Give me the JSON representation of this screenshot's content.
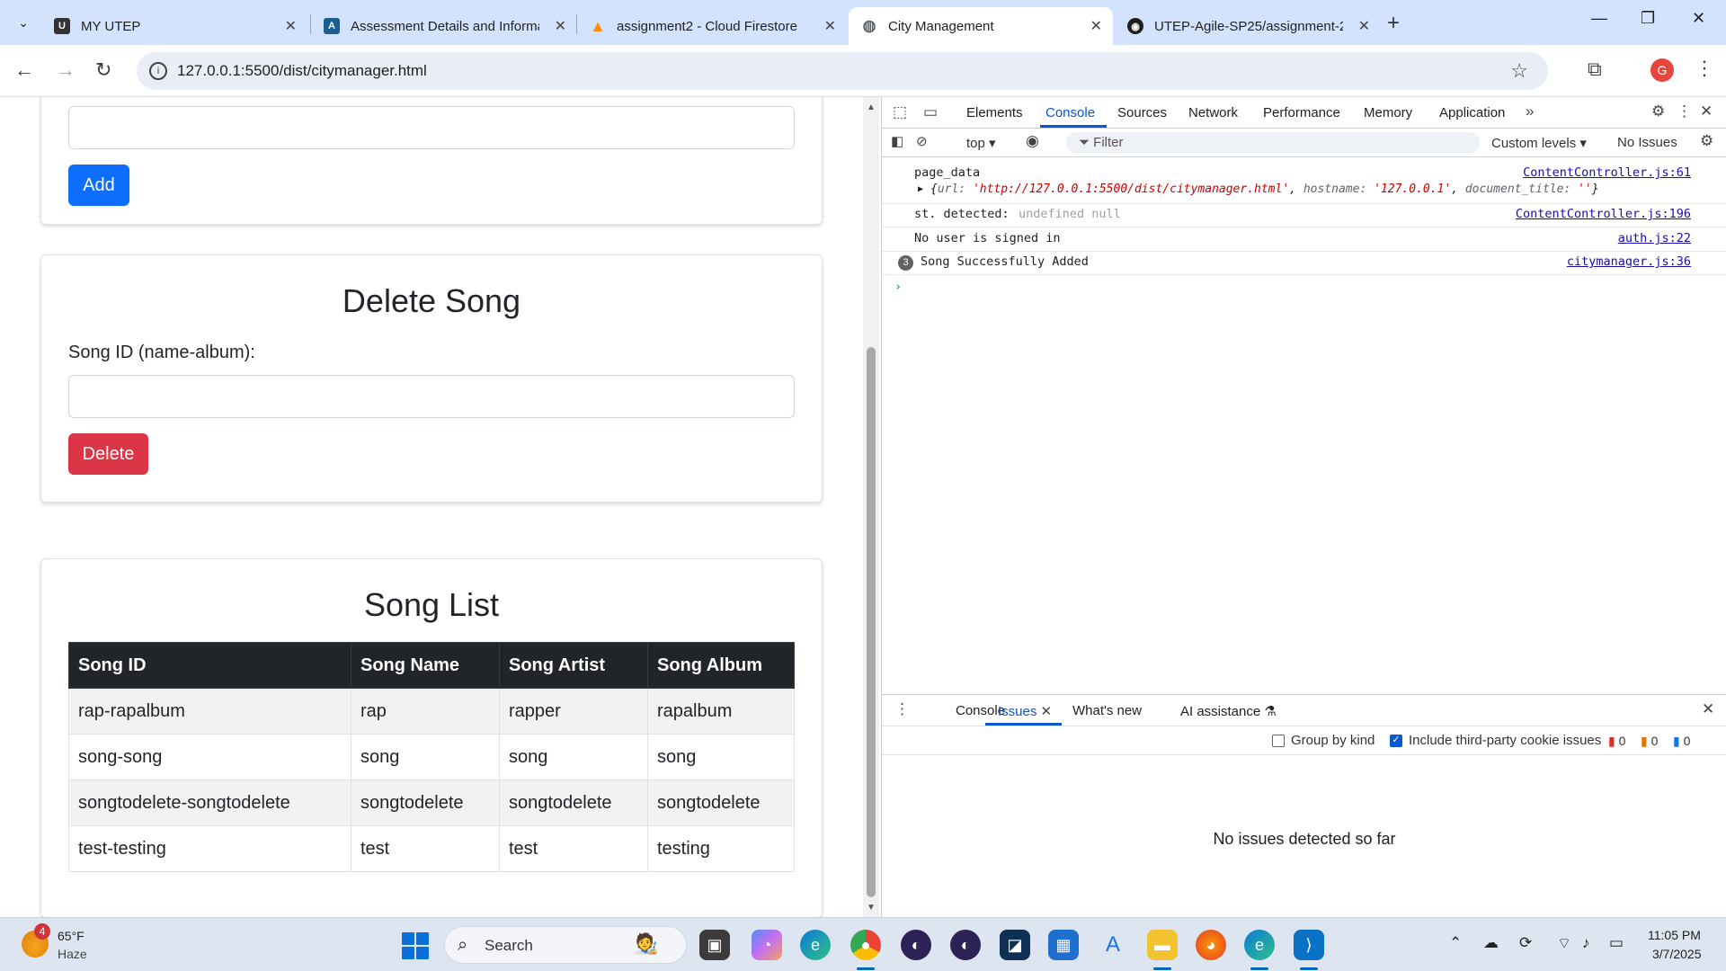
{
  "browser": {
    "tabs": [
      {
        "title": "MY UTEP",
        "fav": "utep-icon",
        "color": "#333333"
      },
      {
        "title": "Assessment Details and Informa",
        "fav": "assessment-icon",
        "color": "#2b5797"
      },
      {
        "title": "assignment2 - Cloud Firestore",
        "fav": "firebase-icon",
        "color": "#ff8f00"
      },
      {
        "title": "City Management",
        "fav": "globe-icon",
        "color": "#5f6368"
      },
      {
        "title": "UTEP-Agile-SP25/assignment-2",
        "fav": "github-icon",
        "color": "#1f1f1f"
      }
    ],
    "url": "127.0.0.1:5500/dist/citymanager.html",
    "profile_initial": "G"
  },
  "page": {
    "add_button": "Add",
    "delete_card": {
      "title": "Delete Song",
      "label": "Song ID (name-album):",
      "button": "Delete"
    },
    "song_list": {
      "title": "Song List",
      "headers": [
        "Song ID",
        "Song Name",
        "Song Artist",
        "Song Album"
      ],
      "rows": [
        [
          "rap-rapalbum",
          "rap",
          "rapper",
          "rapalbum"
        ],
        [
          "song-song",
          "song",
          "song",
          "song"
        ],
        [
          "songtodelete-songtodelete",
          "songtodelete",
          "songtodelete",
          "songtodelete"
        ],
        [
          "test-testing",
          "test",
          "test",
          "testing"
        ]
      ]
    }
  },
  "devtools": {
    "tabs": [
      "Elements",
      "Console",
      "Sources",
      "Network",
      "Performance",
      "Memory",
      "Application"
    ],
    "active_tab": "Console",
    "context": "top",
    "filter_placeholder": "Filter",
    "levels": "Custom levels",
    "issues_label": "No Issues",
    "console": {
      "line1_label": "page_data",
      "line1_src": "ContentController.js:61",
      "obj_open": "{",
      "obj_url_key": "url:",
      "obj_url_val": "'http://127.0.0.1:5500/dist/citymanager.html'",
      "obj_host_key": "hostname:",
      "obj_host_val": "'127.0.0.1'",
      "obj_title_key": "document_title:",
      "obj_title_val": "''",
      "obj_close": "}",
      "line2_label": "st. detected:",
      "line2_val": "undefined null",
      "line2_src": "ContentController.js:196",
      "line3_label": "No user is signed in",
      "line3_src": "auth.js:22",
      "line4_count": "3",
      "line4_label": "Song Successfully Added",
      "line4_src": "citymanager.js:36"
    },
    "drawer": {
      "tabs": [
        "Console",
        "Issues",
        "What's new",
        "AI assistance"
      ],
      "active_tab": "Issues",
      "group_by_kind": "Group by kind",
      "include_third_party": "Include third-party cookie issues",
      "counts": [
        "0",
        "0",
        "0"
      ],
      "empty_message": "No issues detected so far"
    }
  },
  "taskbar": {
    "weather_badge": "4",
    "weather_temp": "65°F",
    "weather_desc": "Haze",
    "search_label": "Search",
    "time": "11:05 PM",
    "date": "3/7/2025"
  }
}
